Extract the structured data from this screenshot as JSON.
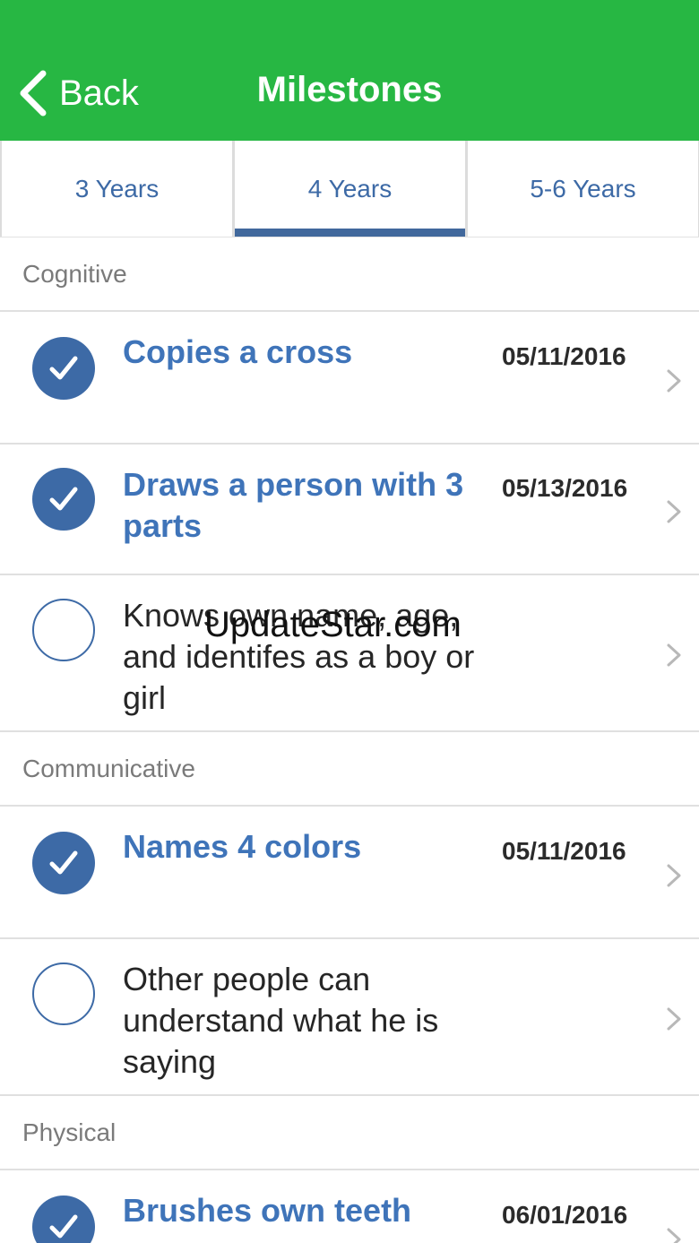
{
  "nav": {
    "back_label": "Back",
    "title": "Milestones"
  },
  "tabs": [
    {
      "label": "3 Years",
      "active": false
    },
    {
      "label": "4 Years",
      "active": true
    },
    {
      "label": "5-6 Years",
      "active": false
    }
  ],
  "sections": {
    "cognitive": {
      "title": "Cognitive",
      "items": [
        {
          "title": "Copies a cross",
          "date": "05/11/2016",
          "achieved": true
        },
        {
          "title": "Draws a person with 3 parts",
          "date": "05/13/2016",
          "achieved": true
        },
        {
          "title": "Knows own name, age, and identifes as a boy or girl",
          "date": "",
          "achieved": false
        }
      ]
    },
    "communicative": {
      "title": "Communicative",
      "items": [
        {
          "title": "Names 4 colors",
          "date": "05/11/2016",
          "achieved": true
        },
        {
          "title": "Other people can understand what he is saying",
          "date": "",
          "achieved": false
        }
      ]
    },
    "physical": {
      "title": "Physical",
      "items": [
        {
          "title": "Brushes own teeth",
          "date": "06/01/2016",
          "achieved": true
        }
      ]
    }
  },
  "watermark": "UpdateStar.com",
  "icons": {
    "back": "chevron-left-icon",
    "check": "checkmark-icon",
    "disclosure": "chevron-right-icon"
  },
  "colors": {
    "navbar": "#27b743",
    "accent": "#3d6aa6",
    "achieved_title": "#3f74b9"
  }
}
